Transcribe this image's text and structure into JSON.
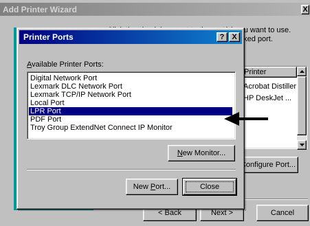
{
  "wizard": {
    "title": "Add Printer Wizard",
    "close_glyph": "X",
    "instructions": "Click the check box next to the port(s) you want to use. Documents will print to the first free checked port.",
    "port_list": {
      "header": "Printer",
      "rows": [
        "Acrobat Distiller",
        "HP DeskJet ..."
      ]
    },
    "buttons": {
      "configure_port": "Configure Port...",
      "back": "< Back",
      "next": "Next >",
      "cancel": "Cancel"
    }
  },
  "ports_dialog": {
    "title": "Printer Ports",
    "help_glyph": "?",
    "close_glyph": "X",
    "available_label_mnemonic": "A",
    "available_label_rest": "vailable Printer Ports:",
    "ports": [
      "Digital Network Port",
      "Lexmark DLC Network Port",
      "Lexmark TCP/IP Network Port",
      "Local Port",
      "LPR Port",
      "PDF Port",
      "Troy Group ExtendNet Connect IP Monitor"
    ],
    "selected_port": "LPR Port",
    "buttons": {
      "new_monitor_mnemonic": "N",
      "new_monitor_rest": "ew Monitor...",
      "new_port_prefix": "New ",
      "new_port_mnemonic": "P",
      "new_port_rest": "ort...",
      "close": "Close"
    }
  },
  "colors": {
    "active_title_start": "#000080",
    "active_title_end": "#1084d0",
    "selection": "#000080",
    "face": "#c0c0c0",
    "wizard_graphic": "#009999"
  }
}
